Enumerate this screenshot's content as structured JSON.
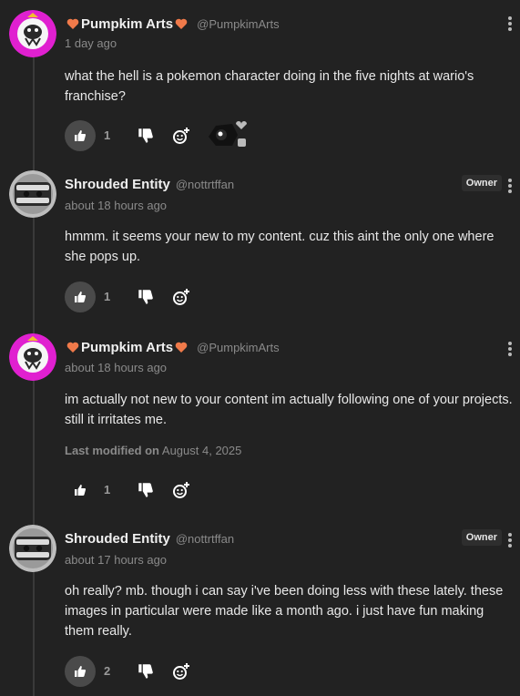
{
  "comments": [
    {
      "author": "Pumpkim Arts",
      "handle": "@PumpkimArts",
      "time": "1 day ago",
      "owner": "",
      "text": "what the hell is a pokemon character doing in the five nights at wario's franchise?",
      "modified_label": "",
      "modified_date": "",
      "likes": "1",
      "avatar": "pumpkim-avatar"
    },
    {
      "author": "Shrouded Entity",
      "handle": "@nottrtffan",
      "time": "about 18 hours ago",
      "owner": "Owner",
      "text": "hmmm. it seems your new to my content. cuz this aint the only one where she pops up.",
      "modified_label": "",
      "modified_date": "",
      "likes": "1",
      "avatar": "shrouded-avatar"
    },
    {
      "author": "Pumpkim Arts",
      "handle": "@PumpkimArts",
      "time": "about 18 hours ago",
      "owner": "",
      "text": "im actually not new to your content im actually following one of your projects. still it irritates me.",
      "modified_label": "Last modified on",
      "modified_date": "August 4, 2025",
      "likes": "1",
      "avatar": "pumpkim-avatar"
    },
    {
      "author": "Shrouded Entity",
      "handle": "@nottrtffan",
      "time": "about 17 hours ago",
      "owner": "Owner",
      "text": "oh really? mb. though i can say i've been doing less with these lately. these images in particular were made like a month ago. i just have fun making them really.",
      "modified_label": "",
      "modified_date": "",
      "likes": "2",
      "avatar": "shrouded-avatar"
    }
  ],
  "icons": {
    "like": "thumbs-up-icon",
    "dislike": "thumbs-down-icon",
    "react": "add-reaction-icon",
    "menu": "kebab-menu-icon",
    "heart": "orange-heart-icon"
  },
  "colors": {
    "background": "#222222",
    "heart": "#f07a4a",
    "pumpkim_avatar": "#e020d0",
    "like_button": "#4a4a4a"
  }
}
